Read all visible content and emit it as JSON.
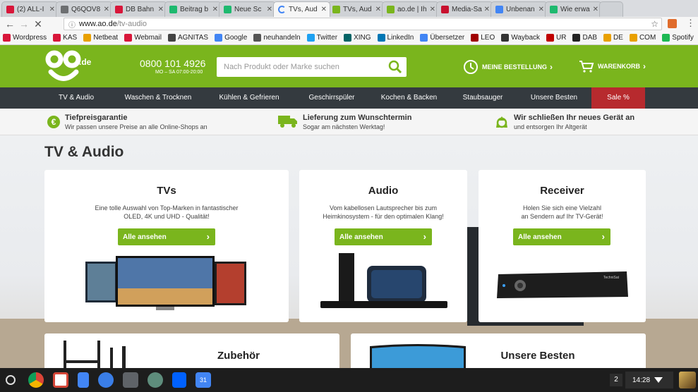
{
  "tabs": [
    {
      "title": "(2) ALL-I",
      "fav": "#d8163a"
    },
    {
      "title": "Q6QOV8",
      "fav": "#6d6f71"
    },
    {
      "title": "DB Bahn",
      "fav": "#d8163a"
    },
    {
      "title": "Beitrag b",
      "fav": "#1eb96f"
    },
    {
      "title": "Neue Sc",
      "fav": "#1eb96f"
    },
    {
      "title": "TVs, Aud",
      "fav": "#888888"
    },
    {
      "title": "TVs, Aud",
      "fav": "#7ab51d"
    },
    {
      "title": "ao.de | Ih",
      "fav": "#7ab51d"
    },
    {
      "title": "Media-Sa",
      "fav": "#c8102e"
    },
    {
      "title": "Unbenan",
      "fav": "#4285f4"
    },
    {
      "title": "Wie erwa",
      "fav": "#1eb96f"
    }
  ],
  "address": {
    "host": "www.ao.de",
    "path": "/tv-audio"
  },
  "bookmarks": [
    {
      "label": "Wordpress",
      "color": "#d8163a"
    },
    {
      "label": "KAS",
      "color": "#d8163a"
    },
    {
      "label": "Netbeat",
      "color": "#e9a000"
    },
    {
      "label": "Webmail",
      "color": "#d8163a"
    },
    {
      "label": "AGNITAS",
      "color": "#444444"
    },
    {
      "label": "Google",
      "color": "#4285f4"
    },
    {
      "label": "neuhandeln",
      "color": "#555555"
    },
    {
      "label": "Twitter",
      "color": "#1da1f2"
    },
    {
      "label": "XING",
      "color": "#026466"
    },
    {
      "label": "LinkedIn",
      "color": "#0077b5"
    },
    {
      "label": "Übersetzer",
      "color": "#4285f4"
    },
    {
      "label": "LEO",
      "color": "#a00000"
    },
    {
      "label": "Wayback",
      "color": "#333333"
    },
    {
      "label": "UR",
      "color": "#c00000"
    },
    {
      "label": "DAB",
      "color": "#222222"
    },
    {
      "label": "DE",
      "color": "#e9a000"
    },
    {
      "label": "COM",
      "color": "#e9a000"
    },
    {
      "label": "Spotify",
      "color": "#1db954"
    }
  ],
  "header": {
    "logo_text": "ao",
    "logo_suffix": ".de",
    "phone": "0800 101 4926",
    "hours": "MO – SA 07:00-20:00",
    "search_placeholder": "Nach Produkt oder Marke suchen",
    "order_label": "MEINE BESTELLUNG",
    "cart_label": "WARENKORB"
  },
  "nav": [
    "TV & Audio",
    "Waschen & Trocknen",
    "Kühlen & Gefrieren",
    "Geschirrspüler",
    "Kochen & Backen",
    "Staubsauger",
    "Unsere Besten",
    "Sale %"
  ],
  "usps": [
    {
      "title": "Tiefpreisgarantie",
      "sub": "Wir passen unsere Preise an alle Online-Shops an"
    },
    {
      "title": "Lieferung zum Wunschtermin",
      "sub": "Sogar am nächsten Werktag!"
    },
    {
      "title": "Wir schließen Ihr neues Gerät an",
      "sub": "und entsorgen Ihr Altgerät"
    }
  ],
  "page_title": "TV & Audio",
  "cards": [
    {
      "title": "TVs",
      "desc1": "Eine tolle Auswahl von Top-Marken in fantastischer",
      "desc2": "OLED, 4K und UHD - Qualität!",
      "button": "Alle ansehen"
    },
    {
      "title": "Audio",
      "desc1": "Vom kabellosen Lautsprecher bis zum",
      "desc2": "Heimkinosystem - für den optimalen Klang!",
      "button": "Alle ansehen"
    },
    {
      "title": "Receiver",
      "desc1": "Holen Sie sich eine Vielzahl",
      "desc2": "an Sendern auf Ihr TV-Gerät!",
      "button": "Alle ansehen"
    },
    {
      "title": "Zubehör"
    },
    {
      "title": "Unsere Besten"
    }
  ],
  "receiver_brand": "TechniSat",
  "shelf": {
    "badge": "2",
    "time": "14:28"
  },
  "colors": {
    "brand_green": "#7ab51d",
    "nav_dark": "#343a3f",
    "sale_red": "#b72a2e"
  }
}
